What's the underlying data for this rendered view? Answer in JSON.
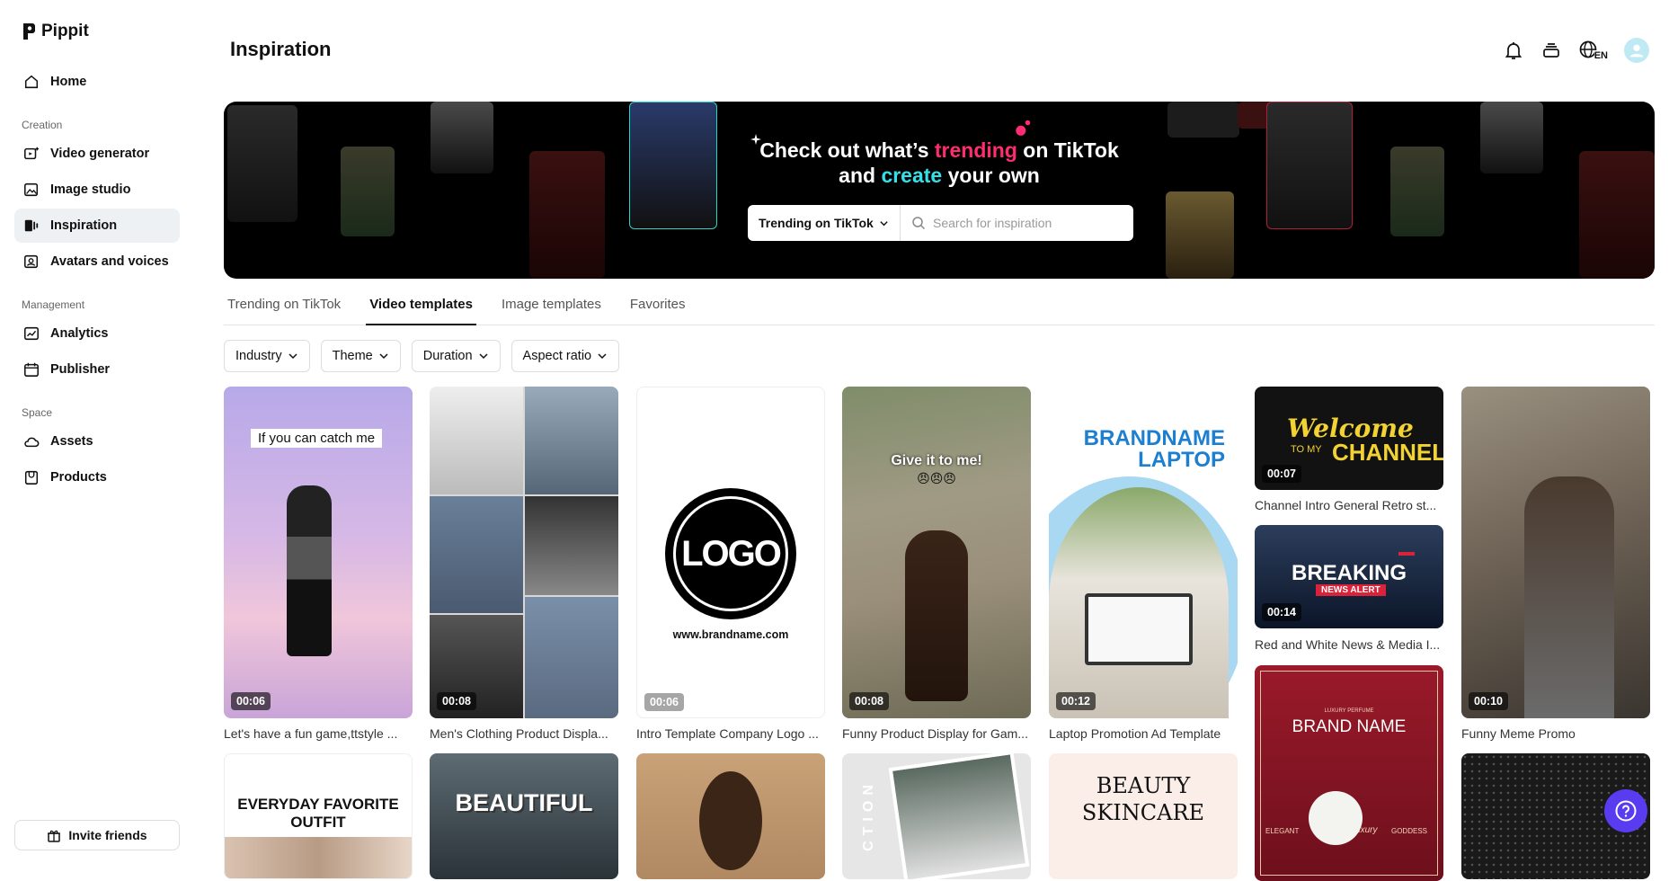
{
  "app": {
    "name": "Pippit"
  },
  "sidebar": {
    "home": "Home",
    "creation_label": "Creation",
    "creation": [
      "Video generator",
      "Image studio",
      "Inspiration",
      "Avatars and voices"
    ],
    "management_label": "Management",
    "management": [
      "Analytics",
      "Publisher"
    ],
    "space_label": "Space",
    "space": [
      "Assets",
      "Products"
    ],
    "invite": "Invite friends"
  },
  "header": {
    "title": "Inspiration",
    "language": "EN"
  },
  "banner": {
    "line1_a": "Check out what’s ",
    "line1_b": "trending",
    "line1_c": " on TikTok",
    "line2_a": "and ",
    "line2_b": "create",
    "line2_c": " your own",
    "dropdown": "Trending on TikTok",
    "search_placeholder": "Search for inspiration"
  },
  "tabs": [
    "Trending on TikTok",
    "Video templates",
    "Image templates",
    "Favorites"
  ],
  "filters": [
    "Industry",
    "Theme",
    "Duration",
    "Aspect ratio"
  ],
  "cards": [
    {
      "title": "Let's have a fun game,ttstyle ...",
      "duration": "00:06",
      "overlay": "If you can catch me"
    },
    {
      "title": "Men's Clothing Product Displa...",
      "duration": "00:08"
    },
    {
      "title": "Intro Template Company Logo ...",
      "duration": "00:06",
      "overlay": "LOGO",
      "overlay2": "www.brandname.com"
    },
    {
      "title": "Funny Product Display for Gam...",
      "duration": "00:08",
      "overlay": "Give it to me!",
      "overlay2": "😠😠😠"
    },
    {
      "title": "Laptop Promotion Ad Template",
      "duration": "00:12",
      "overlay": "BRANDNAME",
      "overlay2": "LAPTOP"
    },
    {
      "title": "Channel Intro General Retro st...",
      "duration": "00:07",
      "overlay": "Welcome",
      "overlay2": "TO MY",
      "overlay3": "CHANNEL"
    },
    {
      "title": "Red and White News & Media I...",
      "duration": "00:14",
      "overlay": "BREAKING",
      "overlay2": "NEWS ALERT"
    },
    {
      "title": "Funny Meme Promo",
      "duration": "00:10"
    }
  ],
  "row2": {
    "outfit": [
      "EVERYDAY FAVORITE",
      "OUTFIT"
    ],
    "beautiful": "BEAUTIFUL",
    "beauty": [
      "BEAUTY",
      "SKINCARE"
    ],
    "brand": {
      "small": "LUXURY PERFUME",
      "name": "BRAND NAME",
      "left": "ELEGANT",
      "mid": "scent of luxury",
      "right": "GODDESS"
    },
    "vertical": "CTION"
  },
  "colors": {
    "brand_pink": "#ff2d6f",
    "brand_cyan": "#33e0e8",
    "help": "#5a3cf0"
  }
}
